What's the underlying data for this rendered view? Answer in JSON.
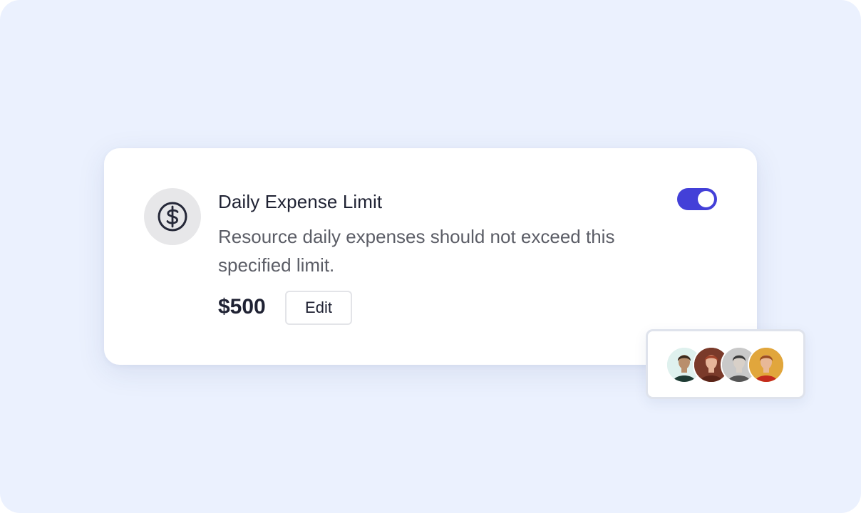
{
  "card": {
    "icon": "dollar-circle-icon",
    "title": "Daily Expense Limit",
    "description": "Resource daily expenses should not exceed this specified limit.",
    "amount": "$500",
    "edit_label": "Edit",
    "toggle_on": true
  },
  "colors": {
    "background": "#ebf1fe",
    "accent": "#4340d8",
    "title": "#1f2233",
    "description": "#5b5d66",
    "icon_bg": "#e7e7e9"
  },
  "avatars": [
    {
      "name": "avatar-1",
      "bg": "#dff1ee",
      "skin": "#b98f6c",
      "hair": "#3b2a1e",
      "shirt": "#1f3b34"
    },
    {
      "name": "avatar-2",
      "bg": "#7a3a2a",
      "skin": "#e7b59a",
      "hair": "#a2432a",
      "shirt": "#5a2418"
    },
    {
      "name": "avatar-3",
      "bg": "#c9c9c9",
      "skin": "#d8d0c8",
      "hair": "#3a3a3a",
      "shirt": "#555555"
    },
    {
      "name": "avatar-4",
      "bg": "#e1a63c",
      "skin": "#e8b897",
      "hair": "#9a4d22",
      "shirt": "#c42a1e"
    }
  ]
}
